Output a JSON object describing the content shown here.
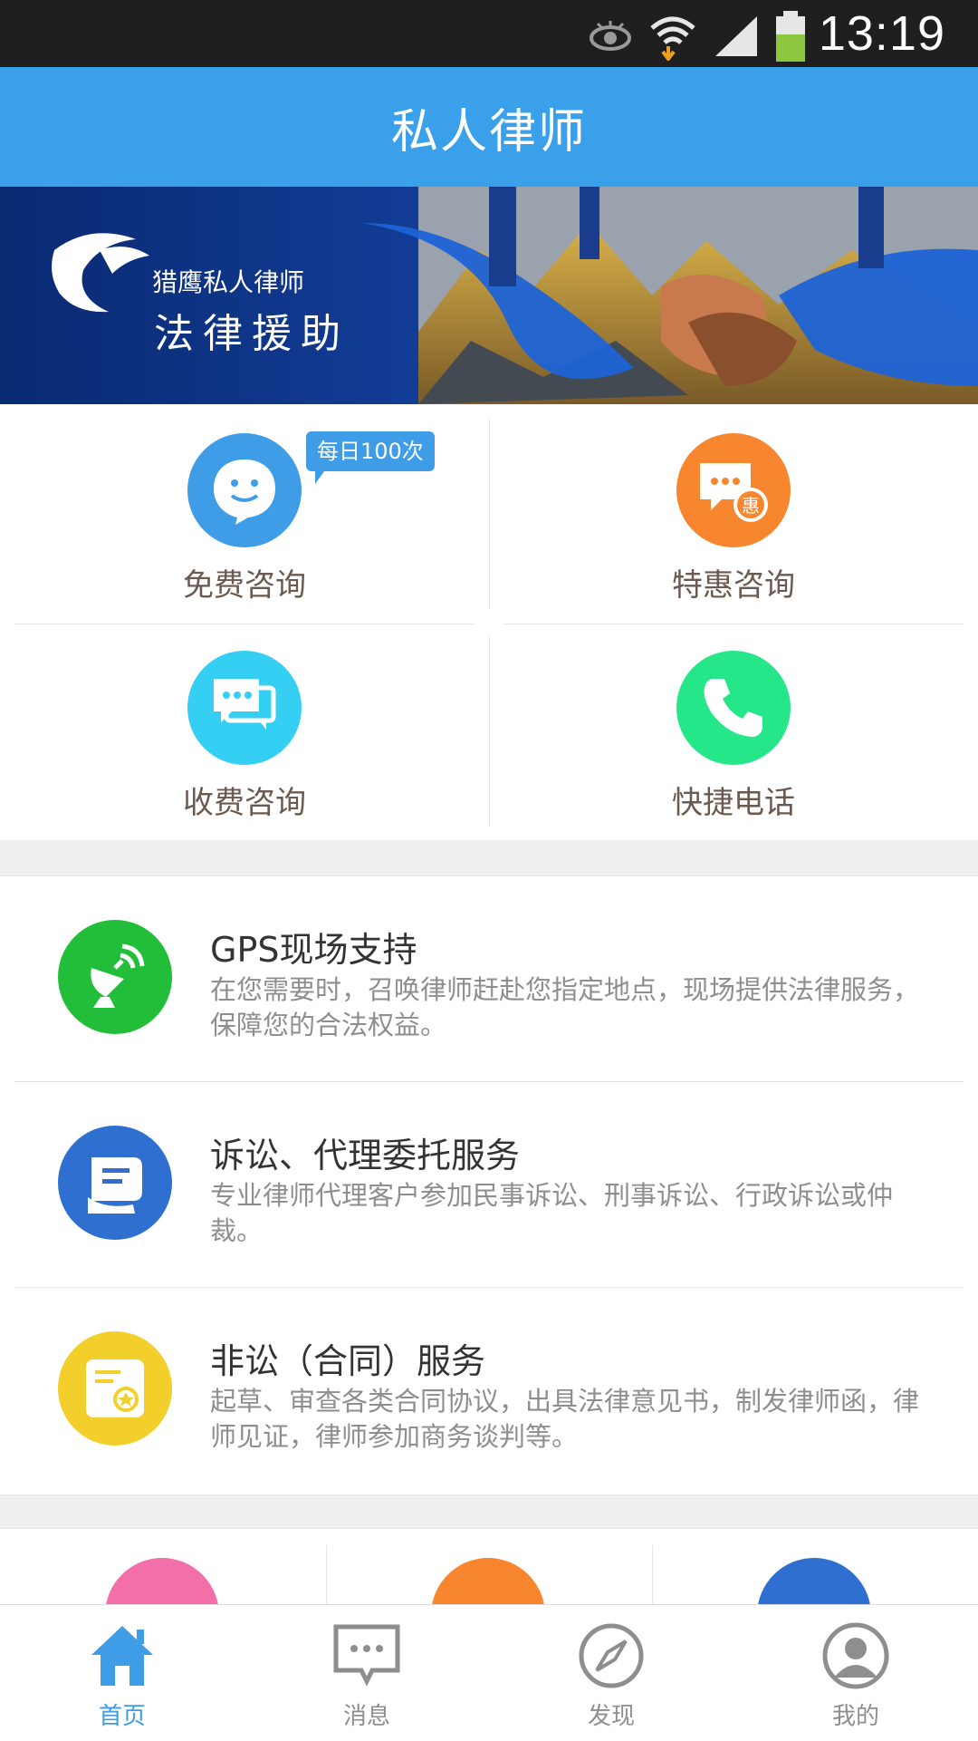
{
  "status": {
    "time": "13:19"
  },
  "header": {
    "title": "私人律师"
  },
  "banner": {
    "brand": "猎鹰私人律师",
    "tagline": "法律援助"
  },
  "quick": [
    {
      "label": "免费咨询",
      "badge": "每日100次",
      "color": "#3e9de6",
      "icon": "smile-chat-icon"
    },
    {
      "label": "特惠咨询",
      "color": "#f7862e",
      "icon": "discount-chat-icon",
      "icon_text": "惠"
    },
    {
      "label": "收费咨询",
      "color": "#35cff3",
      "icon": "chat-bubbles-icon"
    },
    {
      "label": "快捷电话",
      "color": "#26e68a",
      "icon": "phone-icon"
    }
  ],
  "services": [
    {
      "title": "GPS现场支持",
      "desc": "在您需要时，召唤律师赶赴您指定地点，现场提供法律服务，保障您的合法权益。",
      "color": "#22be3a",
      "icon": "satellite-dish-icon"
    },
    {
      "title": "诉讼、代理委托服务",
      "desc": "专业律师代理客户参加民事诉讼、刑事诉讼、行政诉讼或仲裁。",
      "color": "#2f6fcf",
      "icon": "hand-document-icon"
    },
    {
      "title": "非讼（合同）服务",
      "desc": "起草、审查各类合同协议，出具法律意见书，制发律师函，律师见证，律师参加商务谈判等。",
      "color": "#f3cf2b",
      "icon": "contract-seal-icon"
    }
  ],
  "bottom_strip": {
    "colors": [
      "#f36fa8",
      "#f7862e",
      "#2f6fcf"
    ]
  },
  "tabs": [
    {
      "label": "首页",
      "icon": "home-icon",
      "active": true
    },
    {
      "label": "消息",
      "icon": "message-icon",
      "active": false
    },
    {
      "label": "发现",
      "icon": "compass-icon",
      "active": false
    },
    {
      "label": "我的",
      "icon": "profile-icon",
      "active": false
    }
  ],
  "colors": {
    "primary": "#3aa0ea",
    "active_tab": "#3e9de6"
  }
}
